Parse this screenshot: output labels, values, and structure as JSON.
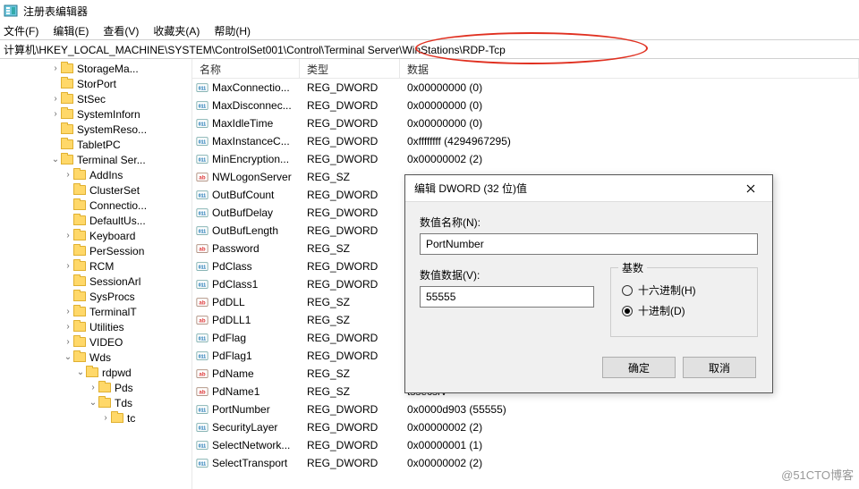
{
  "title": "注册表编辑器",
  "menu": {
    "file": "文件(F)",
    "edit": "编辑(E)",
    "view": "查看(V)",
    "fav": "收藏夹(A)",
    "help": "帮助(H)"
  },
  "path": "计算机\\HKEY_LOCAL_MACHINE\\SYSTEM\\ControlSet001\\Control\\Terminal Server\\WinStations\\RDP-Tcp",
  "columns": {
    "name": "名称",
    "type": "类型",
    "data": "数据"
  },
  "tree": [
    {
      "d": 4,
      "e": ">",
      "t": "StorageMa..."
    },
    {
      "d": 4,
      "e": "",
      "t": "StorPort"
    },
    {
      "d": 4,
      "e": ">",
      "t": "StSec"
    },
    {
      "d": 4,
      "e": ">",
      "t": "SystemInforn"
    },
    {
      "d": 4,
      "e": "",
      "t": "SystemReso..."
    },
    {
      "d": 4,
      "e": "",
      "t": "TabletPC"
    },
    {
      "d": 4,
      "e": "v",
      "t": "Terminal Ser..."
    },
    {
      "d": 5,
      "e": ">",
      "t": "AddIns"
    },
    {
      "d": 5,
      "e": "",
      "t": "ClusterSet"
    },
    {
      "d": 5,
      "e": "",
      "t": "Connectio..."
    },
    {
      "d": 5,
      "e": "",
      "t": "DefaultUs..."
    },
    {
      "d": 5,
      "e": ">",
      "t": "Keyboard"
    },
    {
      "d": 5,
      "e": "",
      "t": "PerSession"
    },
    {
      "d": 5,
      "e": ">",
      "t": "RCM"
    },
    {
      "d": 5,
      "e": "",
      "t": "SessionArl"
    },
    {
      "d": 5,
      "e": "",
      "t": "SysProcs"
    },
    {
      "d": 5,
      "e": ">",
      "t": "TerminalT"
    },
    {
      "d": 5,
      "e": ">",
      "t": "Utilities"
    },
    {
      "d": 5,
      "e": ">",
      "t": "VIDEO"
    },
    {
      "d": 5,
      "e": "v",
      "t": "Wds"
    },
    {
      "d": 6,
      "e": "v",
      "t": "rdpwd"
    },
    {
      "d": 7,
      "e": ">",
      "t": "Pds"
    },
    {
      "d": 7,
      "e": "v",
      "t": "Tds"
    },
    {
      "d": 8,
      "e": ">",
      "t": "tc"
    }
  ],
  "values": [
    {
      "n": "MaxConnectio...",
      "t": "REG_DWORD",
      "d": "0x00000000 (0)",
      "i": "bin"
    },
    {
      "n": "MaxDisconnec...",
      "t": "REG_DWORD",
      "d": "0x00000000 (0)",
      "i": "bin"
    },
    {
      "n": "MaxIdleTime",
      "t": "REG_DWORD",
      "d": "0x00000000 (0)",
      "i": "bin"
    },
    {
      "n": "MaxInstanceC...",
      "t": "REG_DWORD",
      "d": "0xffffffff (4294967295)",
      "i": "bin"
    },
    {
      "n": "MinEncryption...",
      "t": "REG_DWORD",
      "d": "0x00000002 (2)",
      "i": "bin"
    },
    {
      "n": "NWLogonServer",
      "t": "REG_SZ",
      "d": "",
      "i": "str"
    },
    {
      "n": "OutBufCount",
      "t": "REG_DWORD",
      "d": "",
      "i": "bin"
    },
    {
      "n": "OutBufDelay",
      "t": "REG_DWORD",
      "d": "",
      "i": "bin"
    },
    {
      "n": "OutBufLength",
      "t": "REG_DWORD",
      "d": "",
      "i": "bin"
    },
    {
      "n": "Password",
      "t": "REG_SZ",
      "d": "",
      "i": "str"
    },
    {
      "n": "PdClass",
      "t": "REG_DWORD",
      "d": "",
      "i": "bin"
    },
    {
      "n": "PdClass1",
      "t": "REG_DWORD",
      "d": "",
      "i": "bin"
    },
    {
      "n": "PdDLL",
      "t": "REG_SZ",
      "d": "",
      "i": "str"
    },
    {
      "n": "PdDLL1",
      "t": "REG_SZ",
      "d": "",
      "i": "str"
    },
    {
      "n": "PdFlag",
      "t": "REG_DWORD",
      "d": "",
      "i": "bin"
    },
    {
      "n": "PdFlag1",
      "t": "REG_DWORD",
      "d": "",
      "i": "bin"
    },
    {
      "n": "PdName",
      "t": "REG_SZ",
      "d": "",
      "i": "str"
    },
    {
      "n": "PdName1",
      "t": "REG_SZ",
      "d": "tssecsrv",
      "i": "str"
    },
    {
      "n": "PortNumber",
      "t": "REG_DWORD",
      "d": "0x0000d903 (55555)",
      "i": "bin"
    },
    {
      "n": "SecurityLayer",
      "t": "REG_DWORD",
      "d": "0x00000002 (2)",
      "i": "bin"
    },
    {
      "n": "SelectNetwork...",
      "t": "REG_DWORD",
      "d": "0x00000001 (1)",
      "i": "bin"
    },
    {
      "n": "SelectTransport",
      "t": "REG_DWORD",
      "d": "0x00000002 (2)",
      "i": "bin"
    }
  ],
  "dialog": {
    "title": "编辑 DWORD (32 位)值",
    "name_label": "数值名称(N):",
    "name_value": "PortNumber",
    "data_label": "数值数据(V):",
    "data_value": "55555",
    "radix_label": "基数",
    "radix_hex": "十六进制(H)",
    "radix_dec": "十进制(D)",
    "ok": "确定",
    "cancel": "取消"
  },
  "watermark": "@51CTO博客"
}
